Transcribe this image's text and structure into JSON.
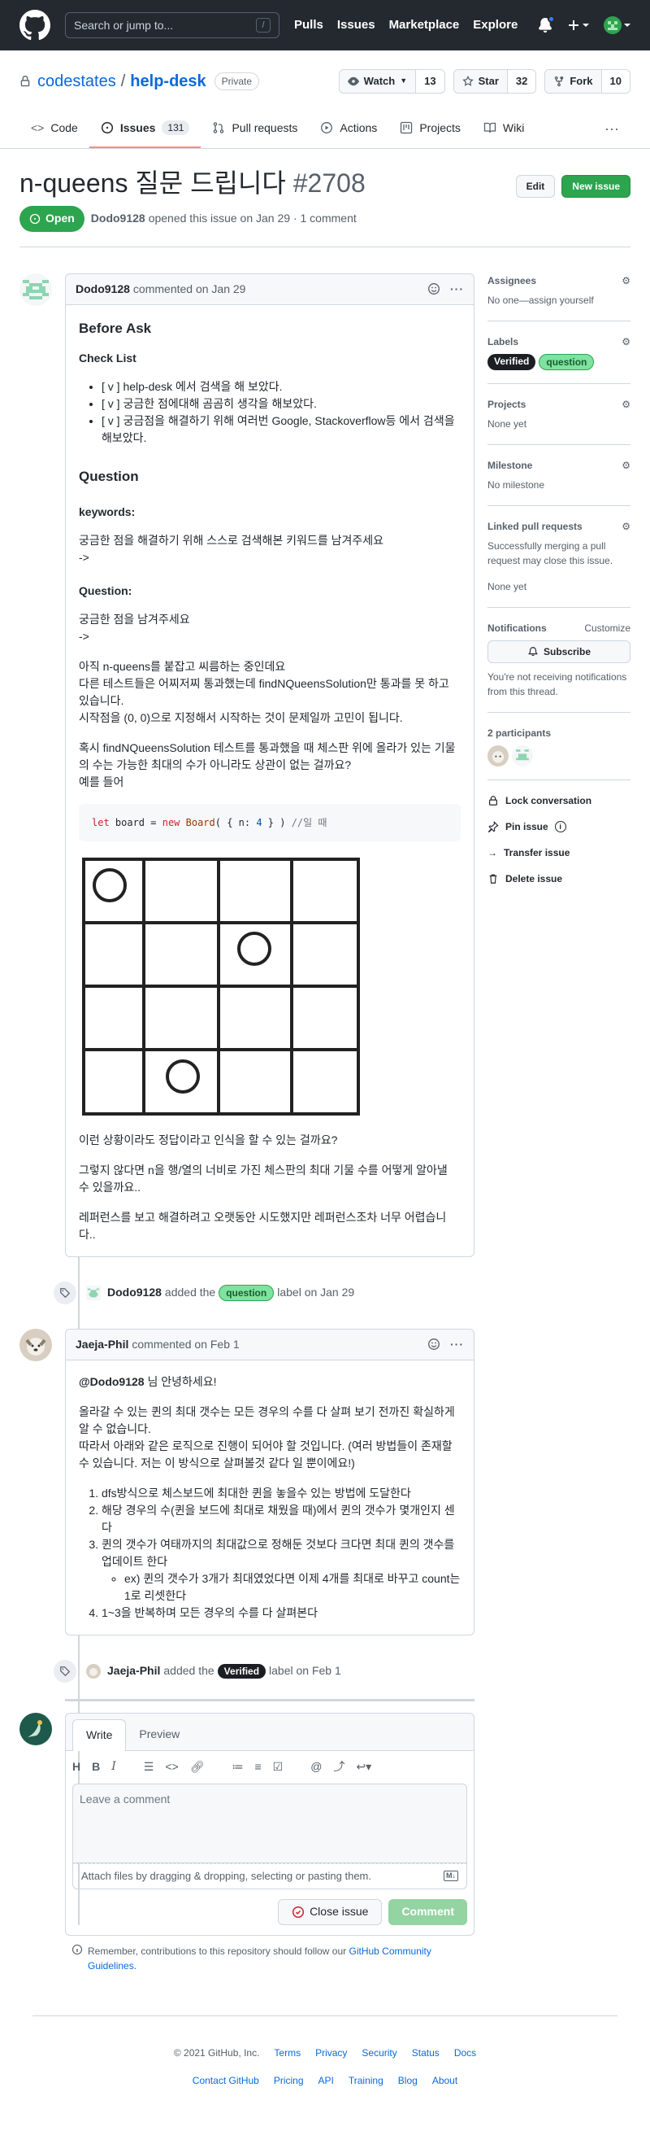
{
  "header": {
    "search_placeholder": "Search or jump to...",
    "search_key": "/",
    "nav": [
      "Pulls",
      "Issues",
      "Marketplace",
      "Explore"
    ]
  },
  "repo": {
    "owner": "codestates",
    "name": "help-desk",
    "visibility": "Private",
    "watch_label": "Watch",
    "watch_count": "13",
    "star_label": "Star",
    "star_count": "32",
    "fork_label": "Fork",
    "fork_count": "10",
    "tabs": [
      {
        "label": "Code"
      },
      {
        "label": "Issues",
        "count": "131"
      },
      {
        "label": "Pull requests"
      },
      {
        "label": "Actions"
      },
      {
        "label": "Projects"
      },
      {
        "label": "Wiki"
      }
    ]
  },
  "issue": {
    "title": "n-queens 질문 드립니다",
    "number": "#2708",
    "edit_label": "Edit",
    "new_issue_label": "New issue",
    "state": "Open",
    "author": "Dodo9128",
    "meta_rest": "opened this issue on Jan 29 · 1 comment"
  },
  "first_comment": {
    "author": "Dodo9128",
    "when": "commented on Jan 29",
    "h_before": "Before Ask",
    "h_checklist": "Check List",
    "checklist": [
      "[ v ] help-desk 에서 검색을 해 보았다.",
      "[ v ] 궁금한 점에대해 곰곰히 생각을 해보았다.",
      "[ v ] 궁금점을 해결하기 위해 여러번 Google, Stackoverflow등 에서 검색을 해보았다."
    ],
    "h_question": "Question",
    "h_keywords": "keywords:",
    "keywords_text": "궁금한 점을 해결하기 위해 스스로 검색해본 키워드를 남겨주세요",
    "arrow1": "->",
    "h_question2": "Question:",
    "question_text": "궁금한 점을 남겨주세요",
    "arrow2": "->",
    "p1_l1": "아직 n-queens를 붙잡고 씨름하는 중인데요",
    "p1_l2": "다른 테스트들은 어찌저찌 통과했는데 findNQueensSolution만 통과를 못 하고 있습니다.",
    "p1_l3": "시작점을 (0, 0)으로 지정해서 시작하는 것이 문제일까 고민이 됩니다.",
    "p2_l1": "혹시 findNQueensSolution 테스트를 통과했을 때 체스판 위에 올라가 있는 기물의 수는 가능한 최대의 수가 아니라도 상관이 없는 걸까요?",
    "p2_l2": "예를 들어",
    "code_let": "let",
    "code_var": " board = ",
    "code_new": "new",
    "code_cls": " Board",
    "code_open": "( { n: ",
    "code_num": "4",
    "code_close": " } ) ",
    "code_comment": "//일 때",
    "p3": "이런 상황이라도 정답이라고 인식을 할 수 있는 걸까요?",
    "p4": "그렇지 않다면 n을 행/열의 너비로 가진 체스판의 최대 기물 수를 어떻게 알아낼 수 있을까요..",
    "p5": "레퍼런스를 보고 해결하려고 오랫동안 시도했지만 레퍼런스조차 너무 어렵습니다.."
  },
  "event1": {
    "author": "Dodo9128",
    "action": "added the",
    "label": "question",
    "when": "label on Jan 29"
  },
  "second_comment": {
    "author": "Jaeja-Phil",
    "when": "commented on Feb 1",
    "mention": "@Dodo9128",
    "greet": " 님 안녕하세요!",
    "p1_l1": "올라갈 수 있는 퀸의 최대 갯수는 모든 경우의 수를 다 살펴 보기 전까진 확실하게 알 수 없습니다.",
    "p1_l2": "따라서 아래와 같은 로직으로 진행이 되어야 할 것입니다. (여러 방법들이 존재할 수 있습니다. 저는 이 방식으로 살펴볼것 같다 일 뿐이에요!)",
    "steps": [
      "dfs방식으로 체스보드에 최대한 퀸을 놓을수 있는 방법에 도달한다",
      "해당 경우의 수(퀸을 보드에 최대로 채웠을 때)에서 퀸의 갯수가 몇개인지 센다",
      "퀸의 갯수가 여태까지의 최대값으로 정해둔 것보다 크다면 최대 퀸의 갯수를 업데이트 한다"
    ],
    "sub": "ex) 퀸의 갯수가 3개가 최대였었다면 이제 4개를 최대로 바꾸고 count는 1로 리셋한다",
    "step4": "1~3을 반복하며 모든 경우의 수를 다 살펴본다"
  },
  "event2": {
    "author": "Jaeja-Phil",
    "action": "added the",
    "label": "Verified",
    "when": "label on Feb 1"
  },
  "sidebar": {
    "assignees_h": "Assignees",
    "assignees_v": "No one—assign yourself",
    "labels_h": "Labels",
    "labels": [
      "Verified",
      "question"
    ],
    "projects_h": "Projects",
    "projects_v": "None yet",
    "milestone_h": "Milestone",
    "milestone_v": "No milestone",
    "linked_h": "Linked pull requests",
    "linked_v1": "Successfully merging a pull request may close this issue.",
    "linked_v2": "None yet",
    "notif_h": "Notifications",
    "notif_customize": "Customize",
    "subscribe": "Subscribe",
    "notif_v": "You're not receiving notifications from this thread.",
    "participants_h": "2 participants",
    "lock": "Lock conversation",
    "pin": "Pin issue",
    "transfer": "Transfer issue",
    "delete": "Delete issue"
  },
  "composer": {
    "tab_write": "Write",
    "tab_preview": "Preview",
    "placeholder": "Leave a comment",
    "attach": "Attach files by dragging & dropping, selecting or pasting them.",
    "close_issue": "Close issue",
    "comment": "Comment",
    "tip_pre": "Remember, contributions to this repository should follow our ",
    "tip_link": "GitHub Community Guidelines",
    "tip_post": "."
  },
  "footer": {
    "copyright": "© 2021 GitHub, Inc.",
    "row1": [
      "Terms",
      "Privacy",
      "Security",
      "Status",
      "Docs"
    ],
    "row2": [
      "Contact GitHub",
      "Pricing",
      "API",
      "Training",
      "Blog",
      "About"
    ]
  },
  "colors": {
    "header_bg": "#24292f",
    "open_green": "#2da44e",
    "link_blue": "#0969da",
    "tab_underline": "#fd8c73"
  }
}
